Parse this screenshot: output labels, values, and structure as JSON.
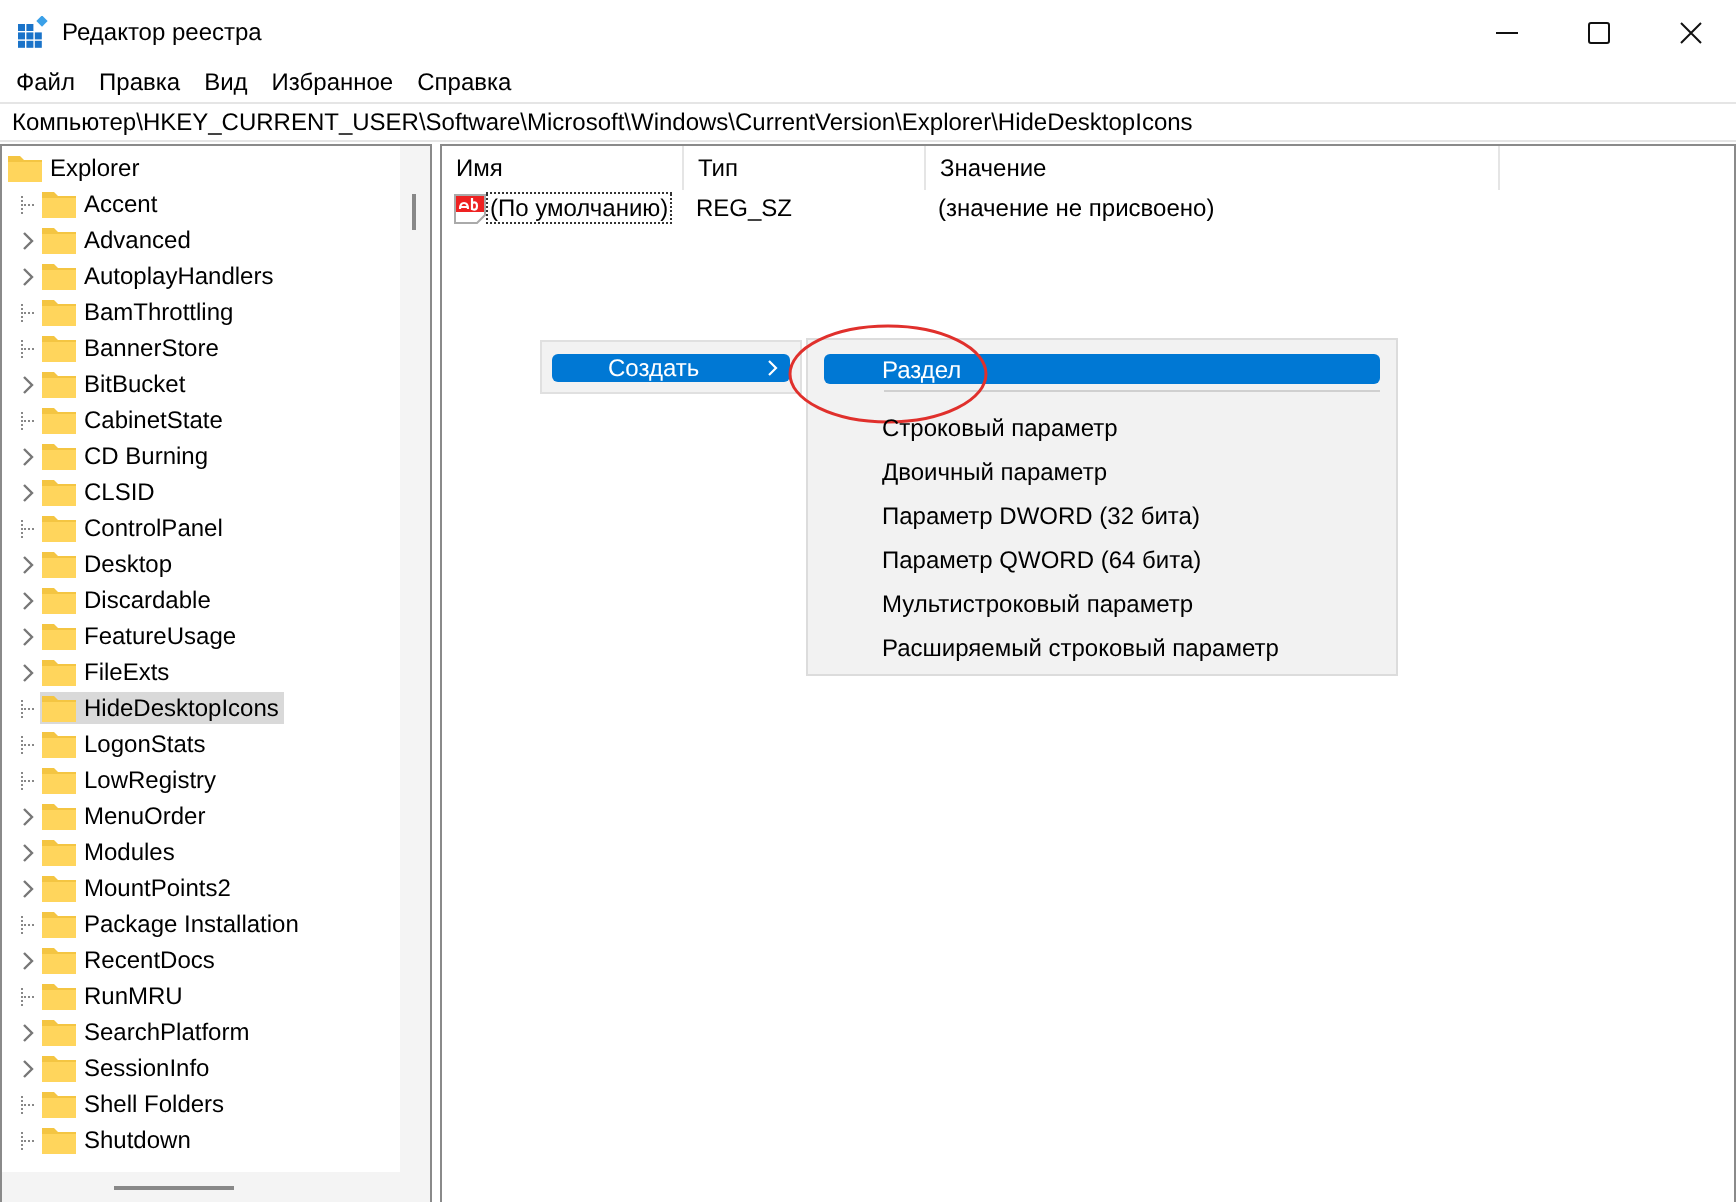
{
  "window": {
    "title": "Редактор реестра"
  },
  "menu_bar": [
    "Файл",
    "Правка",
    "Вид",
    "Избранное",
    "Справка"
  ],
  "address": "Компьютер\\HKEY_CURRENT_USER\\Software\\Microsoft\\Windows\\CurrentVersion\\Explorer\\HideDesktopIcons",
  "tree": {
    "label": "Explorer",
    "selected": false,
    "children": [
      {
        "label": "Accent",
        "expandable": false,
        "selected": false
      },
      {
        "label": "Advanced",
        "expandable": true,
        "selected": false
      },
      {
        "label": "AutoplayHandlers",
        "expandable": true,
        "selected": false
      },
      {
        "label": "BamThrottling",
        "expandable": false,
        "selected": false
      },
      {
        "label": "BannerStore",
        "expandable": false,
        "selected": false
      },
      {
        "label": "BitBucket",
        "expandable": true,
        "selected": false
      },
      {
        "label": "CabinetState",
        "expandable": false,
        "selected": false
      },
      {
        "label": "CD Burning",
        "expandable": true,
        "selected": false
      },
      {
        "label": "CLSID",
        "expandable": true,
        "selected": false
      },
      {
        "label": "ControlPanel",
        "expandable": false,
        "selected": false
      },
      {
        "label": "Desktop",
        "expandable": true,
        "selected": false
      },
      {
        "label": "Discardable",
        "expandable": true,
        "selected": false
      },
      {
        "label": "FeatureUsage",
        "expandable": true,
        "selected": false
      },
      {
        "label": "FileExts",
        "expandable": true,
        "selected": false
      },
      {
        "label": "HideDesktopIcons",
        "expandable": false,
        "selected": true
      },
      {
        "label": "LogonStats",
        "expandable": false,
        "selected": false
      },
      {
        "label": "LowRegistry",
        "expandable": false,
        "selected": false
      },
      {
        "label": "MenuOrder",
        "expandable": true,
        "selected": false
      },
      {
        "label": "Modules",
        "expandable": true,
        "selected": false
      },
      {
        "label": "MountPoints2",
        "expandable": true,
        "selected": false
      },
      {
        "label": "Package Installation",
        "expandable": false,
        "selected": false
      },
      {
        "label": "RecentDocs",
        "expandable": true,
        "selected": false
      },
      {
        "label": "RunMRU",
        "expandable": false,
        "selected": false
      },
      {
        "label": "SearchPlatform",
        "expandable": true,
        "selected": false
      },
      {
        "label": "SessionInfo",
        "expandable": true,
        "selected": false
      },
      {
        "label": "Shell Folders",
        "expandable": false,
        "selected": false
      },
      {
        "label": "Shutdown",
        "expandable": false,
        "selected": false
      }
    ]
  },
  "table": {
    "columns": [
      "Имя",
      "Тип",
      "Значение"
    ],
    "rows": [
      {
        "name": "(По умолчанию)",
        "type": "REG_SZ",
        "value": "(значение не присвоено)"
      }
    ]
  },
  "context_menu": {
    "items": [
      {
        "label": "Создать",
        "selected": true,
        "has_submenu": true
      }
    ]
  },
  "submenu": {
    "items": [
      {
        "kind": "item",
        "label": "Раздел",
        "selected": true,
        "circled": true
      },
      {
        "kind": "separator"
      },
      {
        "kind": "item",
        "label": "Строковый параметр",
        "selected": false,
        "circled": false
      },
      {
        "kind": "item",
        "label": "Двоичный параметр",
        "selected": false,
        "circled": false
      },
      {
        "kind": "item",
        "label": "Параметр DWORD (32 бита)",
        "selected": false,
        "circled": false
      },
      {
        "kind": "item",
        "label": "Параметр QWORD (64 бита)",
        "selected": false,
        "circled": false
      },
      {
        "kind": "item",
        "label": "Мультистроковый параметр",
        "selected": false,
        "circled": false
      },
      {
        "kind": "item",
        "label": "Расширяемый строковый параметр",
        "selected": false,
        "circled": false
      }
    ]
  }
}
